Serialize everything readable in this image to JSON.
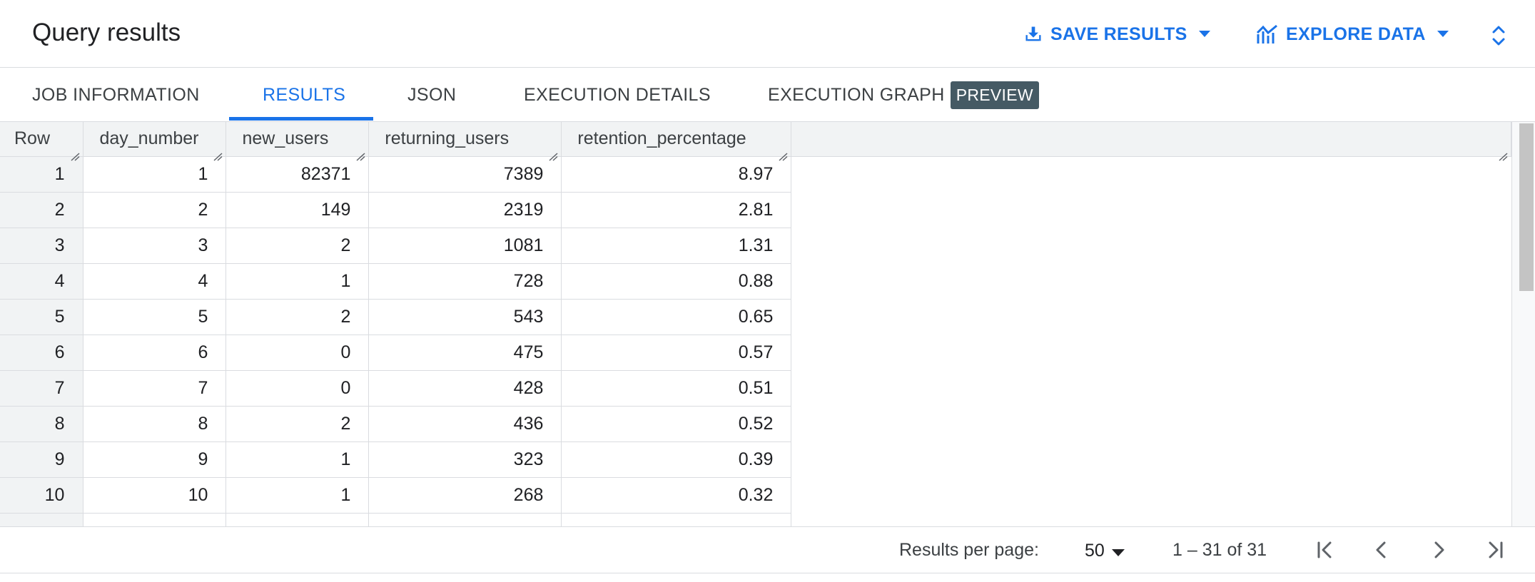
{
  "header": {
    "title": "Query results",
    "save_results_label": "SAVE RESULTS",
    "explore_data_label": "EXPLORE DATA"
  },
  "tabs": [
    {
      "label": "JOB INFORMATION",
      "active": false
    },
    {
      "label": "RESULTS",
      "active": true
    },
    {
      "label": "JSON",
      "active": false
    },
    {
      "label": "EXECUTION DETAILS",
      "active": false
    },
    {
      "label": "EXECUTION GRAPH",
      "active": false,
      "badge": "PREVIEW"
    }
  ],
  "table": {
    "columns": [
      "Row",
      "day_number",
      "new_users",
      "returning_users",
      "retention_percentage"
    ],
    "rows": [
      [
        "1",
        "1",
        "82371",
        "7389",
        "8.97"
      ],
      [
        "2",
        "2",
        "149",
        "2319",
        "2.81"
      ],
      [
        "3",
        "3",
        "2",
        "1081",
        "1.31"
      ],
      [
        "4",
        "4",
        "1",
        "728",
        "0.88"
      ],
      [
        "5",
        "5",
        "2",
        "543",
        "0.65"
      ],
      [
        "6",
        "6",
        "0",
        "475",
        "0.57"
      ],
      [
        "7",
        "7",
        "0",
        "428",
        "0.51"
      ],
      [
        "8",
        "8",
        "2",
        "436",
        "0.52"
      ],
      [
        "9",
        "9",
        "1",
        "323",
        "0.39"
      ],
      [
        "10",
        "10",
        "1",
        "268",
        "0.32"
      ]
    ]
  },
  "footer": {
    "results_per_page_label": "Results per page:",
    "results_per_page_value": "50",
    "range_text": "1 – 31 of 31"
  },
  "colors": {
    "accent": "#1a73e8",
    "header_bg": "#f1f3f4",
    "badge_bg": "#455a64",
    "border": "#dadce0"
  },
  "icons": [
    "download-icon",
    "caret-down-icon",
    "insights-chart-icon",
    "unfold-more-icon",
    "first-page-icon",
    "chevron-left-icon",
    "chevron-right-icon",
    "last-page-icon",
    "column-resize-icon"
  ]
}
